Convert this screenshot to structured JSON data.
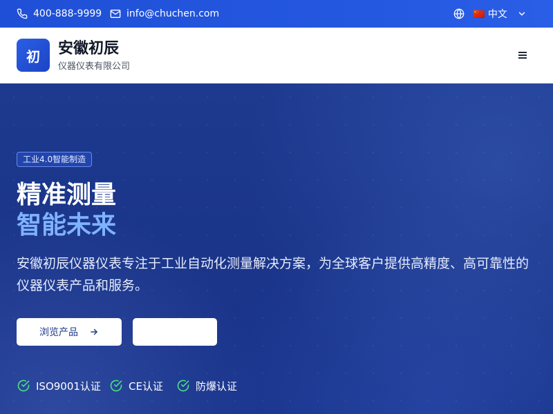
{
  "topbar": {
    "phone": "400-888-9999",
    "email": "info@chuchen.com",
    "language": "🇨🇳 中文"
  },
  "header": {
    "logo_char": "初",
    "brand_name": "安徽初辰",
    "brand_sub": "仪器仪表有限公司"
  },
  "hero": {
    "badge": "工业4.0智能制造",
    "title_line1": "精准测量",
    "title_line2": "智能未来",
    "description": "安徽初辰仪器仪表专注于工业自动化测量解决方案，为全球客户提供高精度、高可靠性的仪器仪表产品和服务。",
    "primary_button": "浏览产品",
    "secondary_button": "",
    "certifications": [
      "ISO9001认证",
      "CE认证",
      "防爆认证"
    ]
  },
  "colors": {
    "topbar_bg": "#2457e0",
    "hero_bg": "#1a3589",
    "accent_text": "#7fb2ff",
    "check_green": "#4ade80"
  }
}
